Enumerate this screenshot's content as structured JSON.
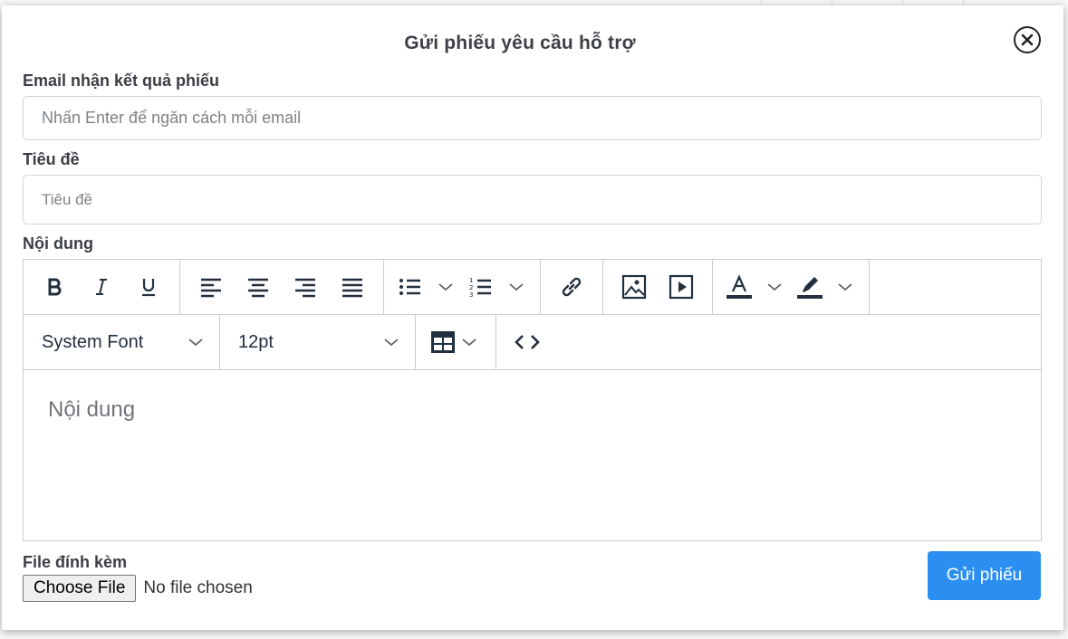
{
  "modal": {
    "title": "Gửi phiếu yêu cầu hỗ trợ",
    "close_icon": "close-circle-icon"
  },
  "form": {
    "email_label": "Email nhận kết quả phiếu",
    "email_placeholder": "Nhấn Enter để ngăn cách mỗi email",
    "email_value": "",
    "subject_label": "Tiêu đề",
    "subject_placeholder": "Tiêu đề",
    "subject_value": "",
    "content_label": "Nội dung",
    "content_placeholder": "Nội dung",
    "attachment_label": "File đính kèm",
    "choose_file_label": "Choose File",
    "no_file_text": "No file chosen",
    "submit_label": "Gửi phiếu"
  },
  "toolbar": {
    "row1": [
      "bold-icon",
      "italic-icon",
      "underline-icon",
      "align-left-icon",
      "align-center-icon",
      "align-right-icon",
      "align-justify-icon",
      "bullet-list-icon",
      "numbered-list-icon",
      "link-icon",
      "image-icon",
      "media-icon",
      "text-color-icon",
      "highlight-icon"
    ],
    "font_family": "System Font",
    "font_size": "12pt",
    "row2_icons": [
      "table-icon",
      "source-code-icon"
    ]
  },
  "colors": {
    "primary": "#2b8ff2",
    "border": "#ced4da",
    "icon": "#222f3e"
  }
}
